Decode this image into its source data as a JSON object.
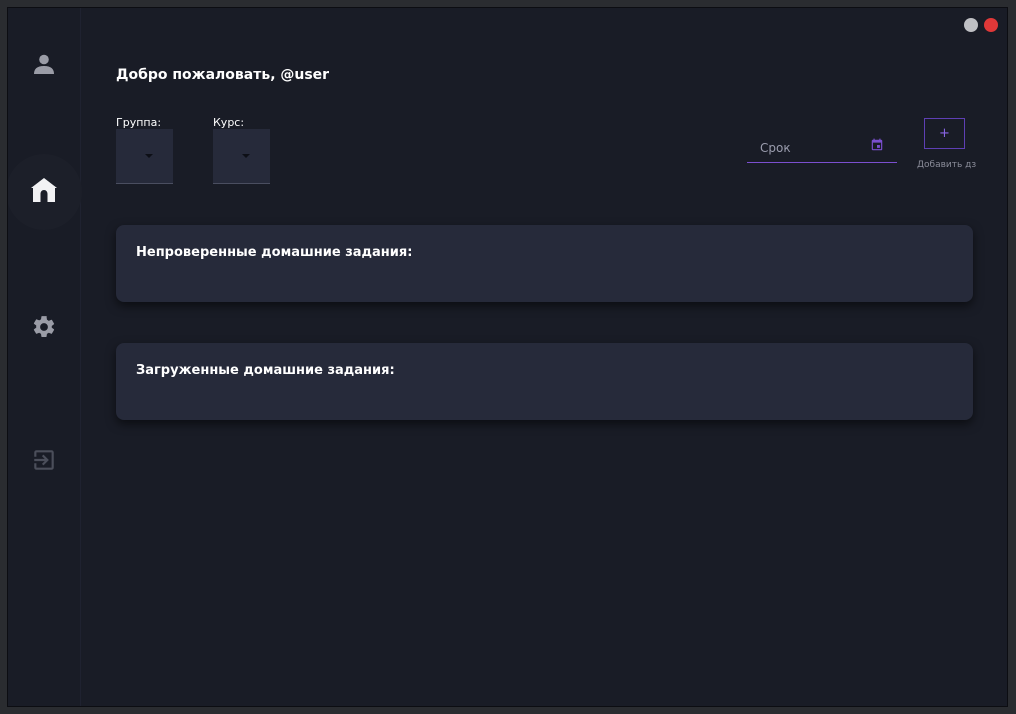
{
  "header": {
    "welcome": "Добро пожаловать, @user"
  },
  "sidebar": {
    "items": [
      {
        "name": "profile",
        "icon": "person-icon"
      },
      {
        "name": "home",
        "icon": "home-icon",
        "active": true
      },
      {
        "name": "settings",
        "icon": "gear-icon"
      },
      {
        "name": "logout",
        "icon": "exit-icon"
      }
    ]
  },
  "window_controls": {
    "minimize_color": "#bfc0c4",
    "close_color": "#e03838"
  },
  "filters": {
    "group_label": "Группа:",
    "group_value": "",
    "course_label": "Курс:",
    "course_value": ""
  },
  "deadline": {
    "placeholder": "Срок"
  },
  "add_homework": {
    "button_label": "+",
    "caption": "Добавить дз"
  },
  "sections": {
    "unchecked_title": "Непроверенные домашние задания:",
    "uploaded_title": "Загруженные домашние задания:"
  },
  "colors": {
    "background": "#191c26",
    "card": "#262a3a",
    "accent": "#7b4fd0"
  }
}
